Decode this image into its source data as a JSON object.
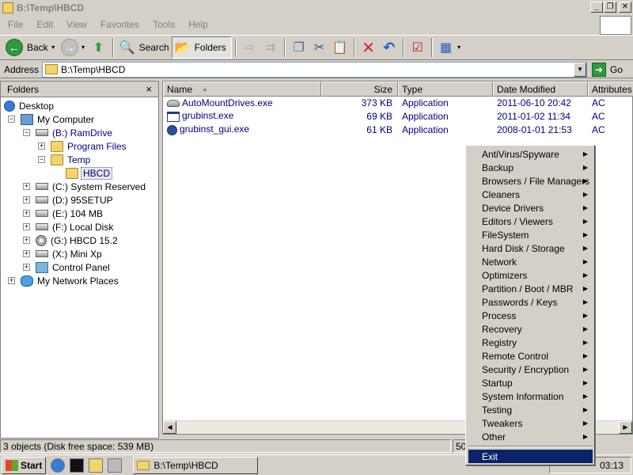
{
  "window": {
    "title": "B:\\Temp\\HBCD"
  },
  "menubar": [
    "File",
    "Edit",
    "View",
    "Favorites",
    "Tools",
    "Help"
  ],
  "toolbar": {
    "back_label": "Back",
    "search_label": "Search",
    "folders_label": "Folders"
  },
  "address": {
    "label": "Address",
    "value": "B:\\Temp\\HBCD",
    "go_label": "Go"
  },
  "folders_pane": {
    "title": "Folders",
    "close_glyph": "×",
    "items": [
      {
        "label": "Desktop"
      },
      {
        "label": "My Computer"
      },
      {
        "label": "(B:) RamDrive"
      },
      {
        "label": "Program Files"
      },
      {
        "label": "Temp"
      },
      {
        "label": "HBCD"
      },
      {
        "label": "(C:) System Reserved"
      },
      {
        "label": "(D:) 95SETUP"
      },
      {
        "label": "(E:) 104 MB"
      },
      {
        "label": "(F:) Local Disk"
      },
      {
        "label": "(G:) HBCD 15.2"
      },
      {
        "label": "(X:) Mini Xp"
      },
      {
        "label": "Control Panel"
      },
      {
        "label": "My Network Places"
      }
    ]
  },
  "file_list": {
    "columns": [
      "Name",
      "Size",
      "Type",
      "Date Modified",
      "Attributes"
    ],
    "rows": [
      {
        "name": "AutoMountDrives.exe",
        "size": "373 KB",
        "type": "Application",
        "modified": "2011-06-10 20:42",
        "attributes": "AC"
      },
      {
        "name": "grubinst.exe",
        "size": "69 KB",
        "type": "Application",
        "modified": "2011-01-02 11:34",
        "attributes": "AC"
      },
      {
        "name": "grubinst_gui.exe",
        "size": "61 KB",
        "type": "Application",
        "modified": "2008-01-01 21:53",
        "attributes": "AC"
      }
    ]
  },
  "status": {
    "objects": "3 objects (Disk free space: 539 MB)",
    "size": "50"
  },
  "taskbar": {
    "start_label": "Start",
    "task_label": "B:\\Temp\\HBCD",
    "clock": "03:13"
  },
  "context_menu": {
    "items": [
      "AntiVirus/Spyware",
      "Backup",
      "Browsers / File Managers",
      "Cleaners",
      "Device Drivers",
      "Editors / Viewers",
      "FileSystem",
      "Hard Disk / Storage",
      "Network",
      "Optimizers",
      "Partition / Boot / MBR",
      "Passwords / Keys",
      "Process",
      "Recovery",
      "Registry",
      "Remote Control",
      "Security / Encryption",
      "Startup",
      "System Information",
      "Testing",
      "Tweakers",
      "Other"
    ],
    "exit_label": "Exit"
  }
}
